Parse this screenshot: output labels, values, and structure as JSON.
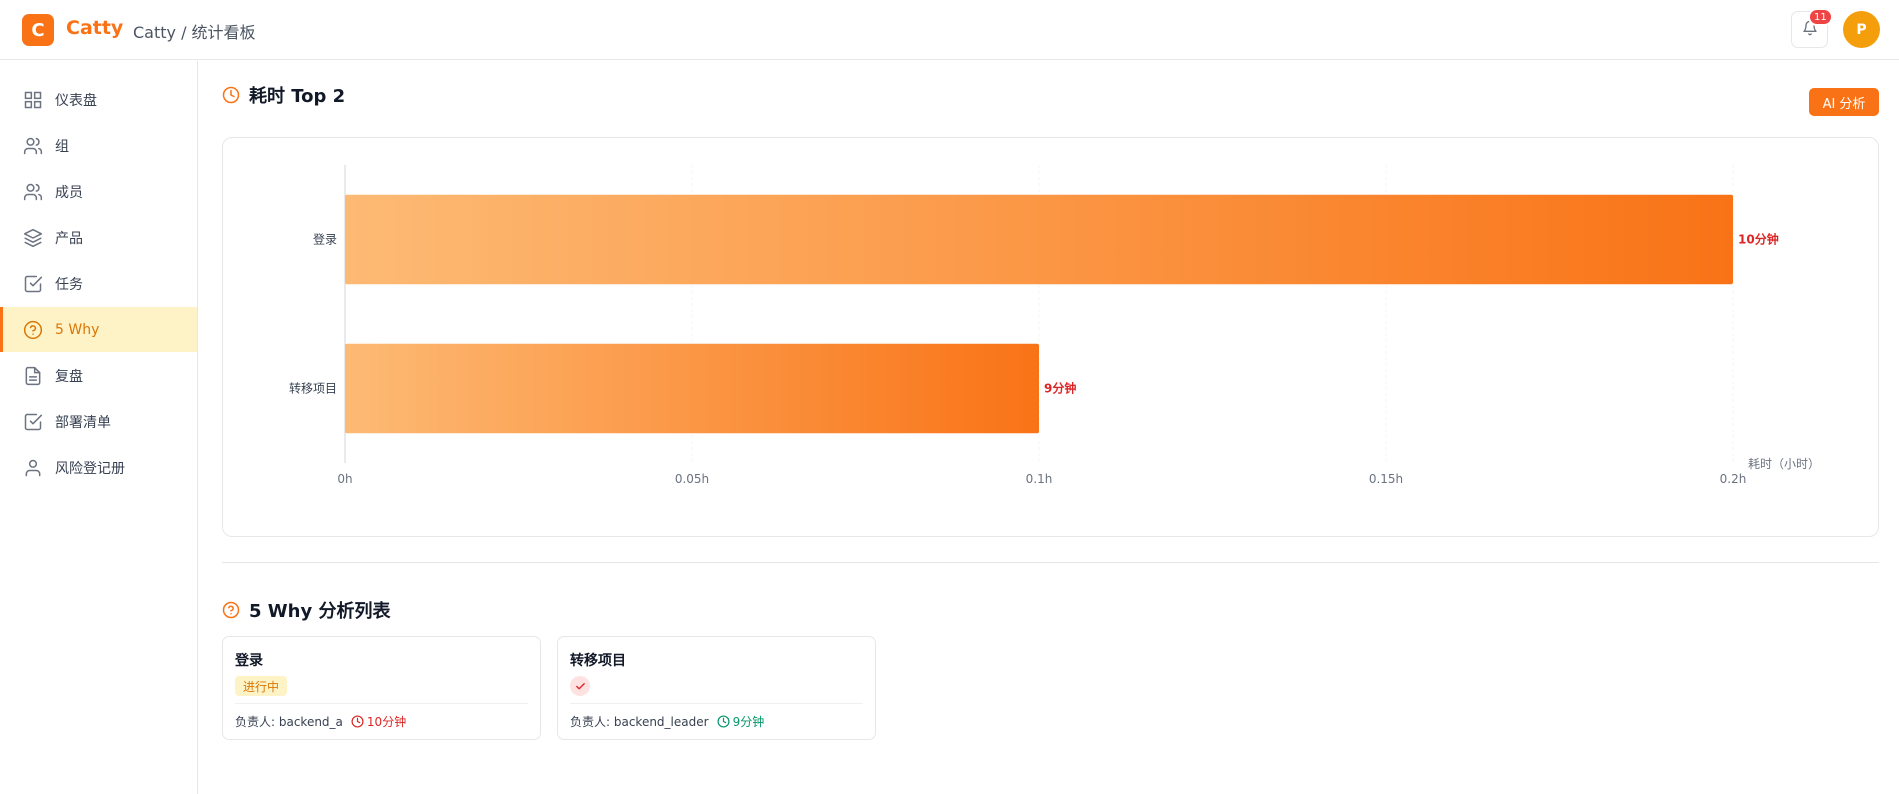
{
  "header": {
    "logo_letter": "C",
    "app_name": "Catty",
    "breadcrumb": "Catty / 统计看板",
    "notification_count": "11",
    "avatar_letter": "P"
  },
  "sidebar": {
    "items": [
      {
        "label": "仪表盘",
        "icon": "grid-icon"
      },
      {
        "label": "组",
        "icon": "users-icon"
      },
      {
        "label": "成员",
        "icon": "users-icon"
      },
      {
        "label": "产品",
        "icon": "layers-icon"
      },
      {
        "label": "任务",
        "icon": "check-square-icon"
      },
      {
        "label": "5 Why",
        "icon": "help-circle-icon",
        "active": true
      },
      {
        "label": "复盘",
        "icon": "file-text-icon"
      },
      {
        "label": "部署清单",
        "icon": "check-square-icon"
      },
      {
        "label": "风险登记册",
        "icon": "user-icon"
      }
    ]
  },
  "main": {
    "chart_section_title": "耗时 Top 2",
    "ai_button": "AI 分析",
    "list_section_title": "5 Why 分析列表",
    "cards": [
      {
        "title": "登录",
        "status": "进行中",
        "owner": "负责人: backend_a",
        "duration": "10分钟",
        "duration_color": "#dc2626"
      },
      {
        "title": "转移项目",
        "status_icon": "check-icon",
        "owner": "负责人: backend_leader",
        "duration": "9分钟",
        "duration_color": "#059669"
      }
    ]
  },
  "chart_data": {
    "type": "bar",
    "orientation": "horizontal",
    "categories": [
      "登录",
      "转移项目"
    ],
    "values": [
      0.2,
      0.1
    ],
    "data_labels": [
      "10分钟",
      "9分钟"
    ],
    "x_ticks": [
      "0h",
      "0.05h",
      "0.1h",
      "0.15h",
      "0.2h"
    ],
    "x_tick_values": [
      0,
      0.05,
      0.1,
      0.15,
      0.2
    ],
    "xlabel": "耗时（小时）",
    "xlim": [
      0,
      0.2
    ],
    "grid": true,
    "colors": {
      "start": "#fdba74",
      "end": "#f97316",
      "label": "#dc2626"
    }
  }
}
